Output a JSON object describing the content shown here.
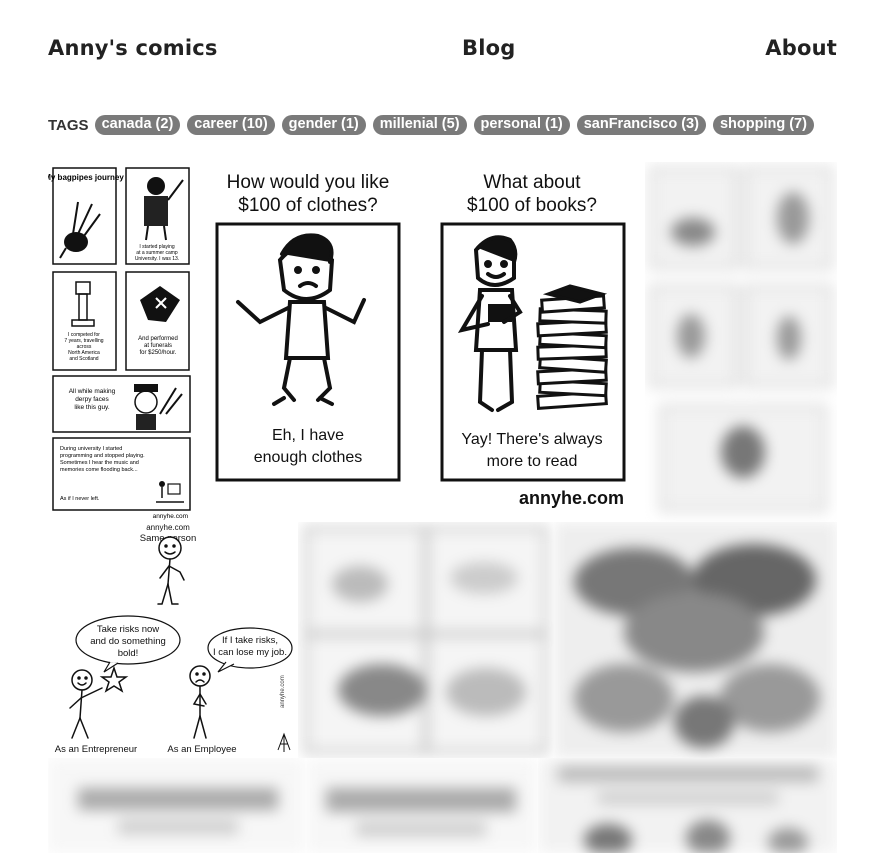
{
  "nav": {
    "brand": "Anny's comics",
    "blog": "Blog",
    "about": "About"
  },
  "tags": {
    "label": "TAGS",
    "items": [
      "canada (2)",
      "career (10)",
      "gender (1)",
      "millenial (5)",
      "personal (1)",
      "sanFrancisco (3)",
      "shopping (7)"
    ]
  },
  "comics": {
    "bagpipes": {
      "panel1": "My bagpipes journey",
      "panel2": "I started playing at a summer camp at Simon Fraser University. I was 13.",
      "panel3": "I competed for 7 years, travelling across North America and Scotland",
      "panel4": "And performed at funerals for $250/hour.",
      "panel5": "All while making derpy faces like this guy.",
      "panel6": "During university I started programming and stopped playing. Sometimes I hear the music and memories come flooding back...",
      "panel6b": "As if I never left.",
      "credit": "annyhe.com"
    },
    "clothes_books": {
      "q1": "How would you like $100 of clothes?",
      "q2": "What about $100 of books?",
      "a1": "Eh, I have enough clothes",
      "a2": "Yay! There's always more to read",
      "credit": "annyhe.com"
    },
    "same_person": {
      "title": "Same person",
      "bubble1": "Take risks now and do something bold!",
      "bubble2": "If I take risks, I can lose my job.",
      "label1": "As an Entrepreneur",
      "label2": "As an Employee",
      "credit": "annyhe.com"
    }
  }
}
